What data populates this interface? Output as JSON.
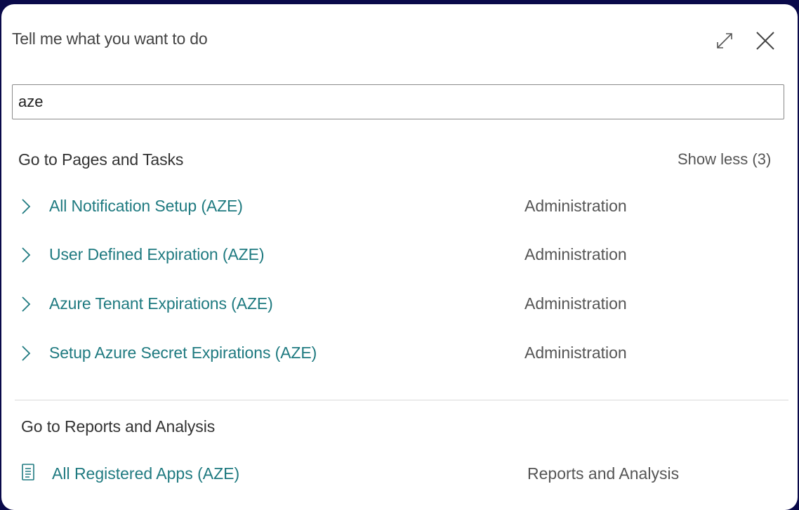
{
  "dialog": {
    "title": "Tell me what you want to do",
    "expand_icon": "expand-icon",
    "close_icon": "close-icon"
  },
  "search": {
    "value": "aze"
  },
  "pages_section": {
    "heading": "Go to Pages and Tasks",
    "toggle_label": "Show less (3)",
    "items": [
      {
        "label": "All Notification Setup (AZE)",
        "category": "Administration"
      },
      {
        "label": "User Defined Expiration (AZE)",
        "category": "Administration"
      },
      {
        "label": "Azure Tenant Expirations (AZE)",
        "category": "Administration"
      },
      {
        "label": "Setup Azure Secret Expirations (AZE)",
        "category": "Administration"
      }
    ]
  },
  "reports_section": {
    "heading": "Go to Reports and Analysis",
    "items": [
      {
        "label": "All Registered Apps (AZE)",
        "category": "Reports and Analysis",
        "icon": "report-document-icon"
      }
    ]
  },
  "colors": {
    "link": "#1f7a80",
    "background": "#0a0a4a"
  }
}
